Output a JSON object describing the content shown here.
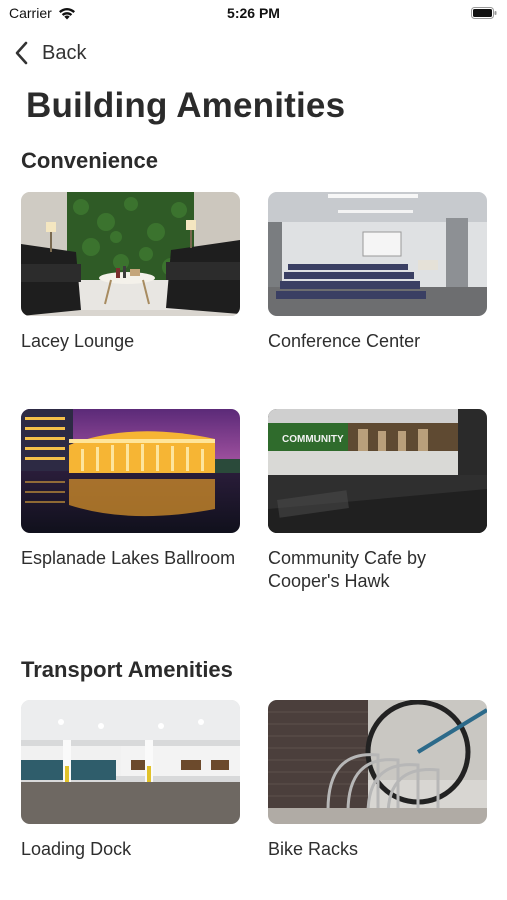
{
  "status_bar": {
    "carrier": "Carrier",
    "time": "5:26 PM"
  },
  "nav": {
    "back_label": "Back"
  },
  "page": {
    "title": "Building Amenities"
  },
  "sections": [
    {
      "title": "Convenience",
      "items": [
        {
          "label": "Lacey Lounge"
        },
        {
          "label": "Conference Center"
        },
        {
          "label": "Esplanade Lakes Ballroom"
        },
        {
          "label": "Community Cafe by Cooper's Hawk"
        }
      ]
    },
    {
      "title": "Transport Amenities",
      "items": [
        {
          "label": "Loading Dock"
        },
        {
          "label": "Bike Racks"
        }
      ]
    }
  ],
  "image_text": {
    "cafe_sign": "COMMUNITY"
  }
}
